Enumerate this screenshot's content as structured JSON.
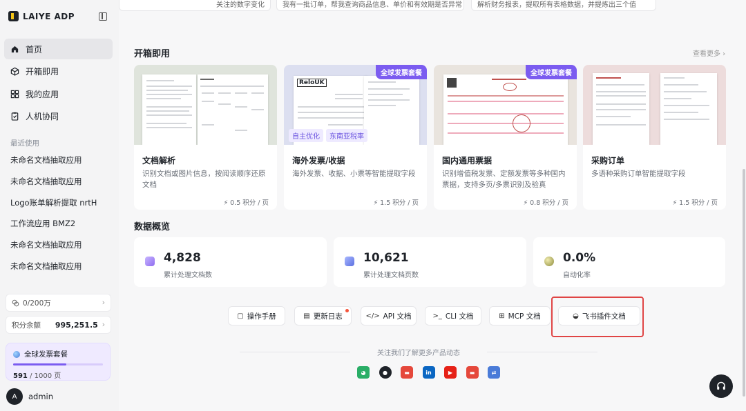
{
  "brand": {
    "name": "LAIYE ADP"
  },
  "sidebar": {
    "nav": [
      {
        "label": "首页",
        "icon": "home-icon"
      },
      {
        "label": "开箱即用",
        "icon": "cube-icon"
      },
      {
        "label": "我的应用",
        "icon": "grid-icon"
      },
      {
        "label": "人机协同",
        "icon": "clipboard-icon"
      }
    ],
    "recent_title": "最近使用",
    "recent": [
      "未命名文档抽取应用",
      "未命名文档抽取应用",
      "Logo账单解析提取 nrtH",
      "工作流应用 BMZ2",
      "未命名文档抽取应用",
      "未命名文档抽取应用"
    ],
    "quota": "0/200万",
    "points_label": "积分余额",
    "points_value": "995,251.5",
    "package": {
      "title": "全球发票套餐",
      "used": "591",
      "total": "/ 1000 页",
      "progress": 0.591
    },
    "user": {
      "initial": "A",
      "name": "admin"
    }
  },
  "prompts": [
    "关注的数字变化",
    "我有一批订单，帮我查询商品信息、单价和有效期是否异常",
    "解析财务报表，提取所有表格数据，并提炼出三个值"
  ],
  "ready": {
    "title": "开箱即用",
    "more": "查看更多 ›",
    "cards": [
      {
        "title": "文档解析",
        "desc": "识别文档或图片信息，按阅读顺序还原文档",
        "cost": "⚡ 0.5 积分 / 页",
        "badge": "",
        "tags": []
      },
      {
        "title": "海外发票/收据",
        "desc": "海外发票、收据、小票等智能提取字段",
        "cost": "⚡ 1.5 积分 / 页",
        "badge": "全球发票套餐",
        "tags": [
          "自主优化",
          "东南亚税率"
        ],
        "logo": "ReloUK"
      },
      {
        "title": "国内通用票据",
        "desc": "识别增值税发票、定额发票等多种国内票据，支持多页/多票识别及验真",
        "cost": "⚡ 0.8 积分 / 页",
        "badge": "全球发票套餐",
        "tags": []
      },
      {
        "title": "采购订单",
        "desc": "多语种采购订单智能提取字段",
        "cost": "⚡ 1.5 积分 / 页",
        "badge": "",
        "tags": []
      }
    ]
  },
  "overview": {
    "title": "数据概览",
    "stats": [
      {
        "value": "4,828",
        "label": "累计处理文档数"
      },
      {
        "value": "10,621",
        "label": "累计处理文档页数"
      },
      {
        "value": "0.0%",
        "label": "自动化率"
      }
    ]
  },
  "links": [
    {
      "label": "操作手册",
      "icon": "book-icon",
      "glyph": "▢"
    },
    {
      "label": "更新日志",
      "icon": "log-icon",
      "glyph": "▤"
    },
    {
      "label": "API 文档",
      "icon": "code-icon",
      "glyph": "</>"
    },
    {
      "label": "CLI 文档",
      "icon": "terminal-icon",
      "glyph": ">_"
    },
    {
      "label": "MCP 文档",
      "icon": "puzzle-icon",
      "glyph": "⊞"
    },
    {
      "label": "飞书插件文档",
      "icon": "feishu-icon",
      "glyph": "◒"
    }
  ],
  "follow_text": "关注我们了解更多产品动态",
  "social": [
    {
      "icon": "wechat-icon",
      "color": "#2aae67",
      "glyph": "◕"
    },
    {
      "icon": "github-icon",
      "color": "#1f2329",
      "glyph": "●"
    },
    {
      "icon": "zhihu-icon",
      "color": "#e5483b",
      "glyph": "▬"
    },
    {
      "icon": "linkedin-icon",
      "color": "#0a66c2",
      "glyph": "in"
    },
    {
      "icon": "youtube-icon",
      "color": "#e62117",
      "glyph": "▶"
    },
    {
      "icon": "bilibili-icon",
      "color": "#e5483b",
      "glyph": "▬"
    },
    {
      "icon": "link-icon",
      "color": "#4a7bd8",
      "glyph": "⇄"
    }
  ],
  "colors": {
    "accent": "#7b5cf0",
    "highlight": "#e04545"
  }
}
